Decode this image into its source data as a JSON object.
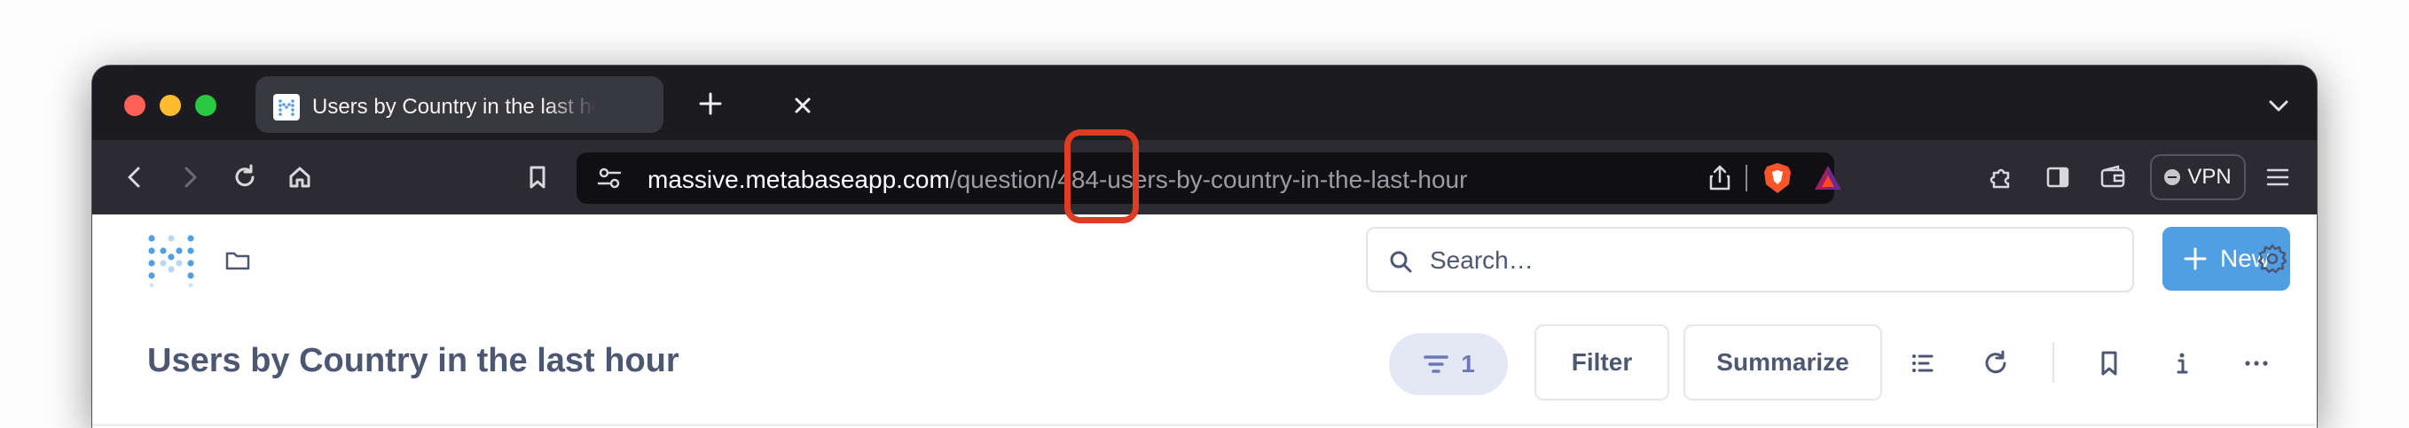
{
  "browser": {
    "tab": {
      "title": "Users by Country in the last hour",
      "favicon": "metabase-logo-icon",
      "close_icon": "close-icon"
    },
    "new_tab_icon": "plus-icon",
    "tab_menu_icon": "chevron-down-icon",
    "toolbar": {
      "back_icon": "back-arrow-icon",
      "forward_icon": "forward-arrow-icon",
      "reload_icon": "reload-icon",
      "home_icon": "home-icon",
      "bookmark_icon": "bookmark-icon",
      "url_host": "massive.metabaseapp.com",
      "url_path": "/question/484-users-by-country-in-the-last-hour",
      "share_icon": "share-icon",
      "shield_icon": "brave-shield-icon",
      "rewards_icon": "brave-rewards-icon",
      "extensions_icon": "puzzle-icon",
      "sidebar_icon": "sidebar-icon",
      "wallet_icon": "wallet-icon",
      "vpn_label": "VPN",
      "menu_icon": "hamburger-icon"
    }
  },
  "metabase": {
    "logo": "metabase-logo-icon",
    "collections_icon": "folder-icon",
    "search": {
      "placeholder": "Search…",
      "value": ""
    },
    "new_button": "New",
    "settings_icon": "gear-icon",
    "question": {
      "title": "Users by Country in the last hour",
      "filter_count": "1",
      "filter_button": "Filter",
      "summarize_button": "Summarize",
      "icons": [
        "list-icon",
        "refresh-icon",
        "bookmark-icon",
        "info-icon",
        "more-icon"
      ]
    }
  },
  "annotation": {
    "color": "#e03b23",
    "highlight": "question-id-in-url"
  },
  "colors": {
    "brand": "#509ee3",
    "text_dark": "#4c5773",
    "filter_pill_bg": "#e4e8f5",
    "filter_pill_text": "#6b79b6",
    "browser_dark": "#1b1b20",
    "toolbar": "#2b2b31"
  }
}
